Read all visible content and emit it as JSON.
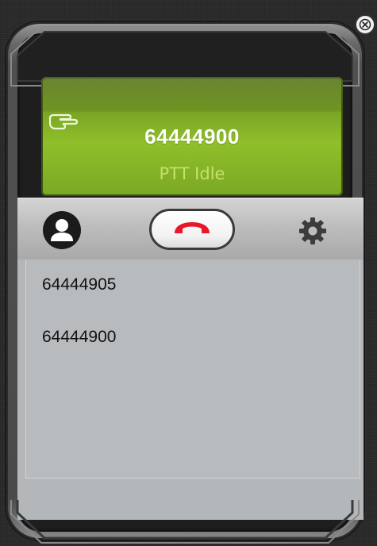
{
  "window": {
    "close_label": "",
    "icons": {
      "close": "close-circle-x-icon"
    }
  },
  "display": {
    "number": "64444900",
    "status": "PTT Idle",
    "icon": "pointing-hand-icon",
    "colors": {
      "panel": "#7aa526",
      "status_text": "#c6e06a",
      "number_text": "#ffffff"
    }
  },
  "toolbar": {
    "icons": {
      "contacts": "person-icon",
      "hangup": "phone-hangup-icon",
      "settings": "gear-icon"
    },
    "colors": {
      "hangup": "#e8172b"
    }
  },
  "call_list": {
    "items": [
      {
        "number": "64444905"
      },
      {
        "number": "64444900"
      }
    ]
  }
}
